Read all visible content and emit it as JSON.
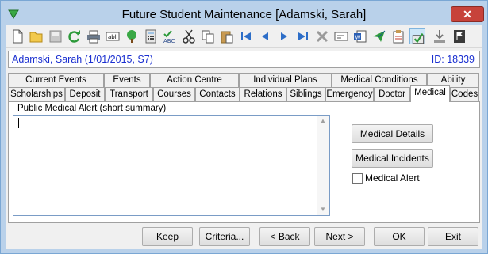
{
  "window": {
    "title": "Future Student Maintenance  [Adamski, Sarah]",
    "close_glyph": "✕"
  },
  "toolbar": {
    "icons": [
      "new-document-icon",
      "open-folder-icon",
      "save-icon",
      "refresh-icon",
      "print-icon",
      "label-icon",
      "tree-icon",
      "calculator-icon",
      "spell-check-icon",
      "cut-icon",
      "copy-icon",
      "paste-icon",
      "first-record-icon",
      "previous-record-icon",
      "next-record-icon",
      "last-record-icon",
      "delete-icon",
      "card-icon",
      "word-document-icon",
      "send-icon",
      "clipboard-icon",
      "edit-record-icon",
      "download-icon",
      "flag-icon"
    ],
    "active_icon": "edit-record-icon"
  },
  "student": {
    "name_line": "Adamski, Sarah (1/01/2015, S7)",
    "id_line": "ID: 18339",
    "color": "#1a2fd0"
  },
  "tabs": {
    "row1": [
      "Current Events",
      "Events",
      "Action Centre",
      "Individual Plans",
      "Medical Conditions",
      "Ability"
    ],
    "row2": [
      "Scholarships",
      "Deposit",
      "Transport",
      "Courses",
      "Contacts",
      "Relations",
      "Siblings",
      "Emergency",
      "Doctor",
      "Medical",
      "Codes"
    ],
    "selected": "Medical"
  },
  "medical": {
    "alert_label": "Public Medical Alert (short summary)",
    "alert_value": "",
    "details_button": "Medical Details",
    "incidents_button": "Medical Incidents",
    "alert_checkbox_label": "Medical Alert",
    "alert_checked": false
  },
  "footer": {
    "keep": "Keep",
    "criteria": "Criteria...",
    "back": "< Back",
    "next": "Next >",
    "ok": "OK",
    "exit": "Exit"
  }
}
